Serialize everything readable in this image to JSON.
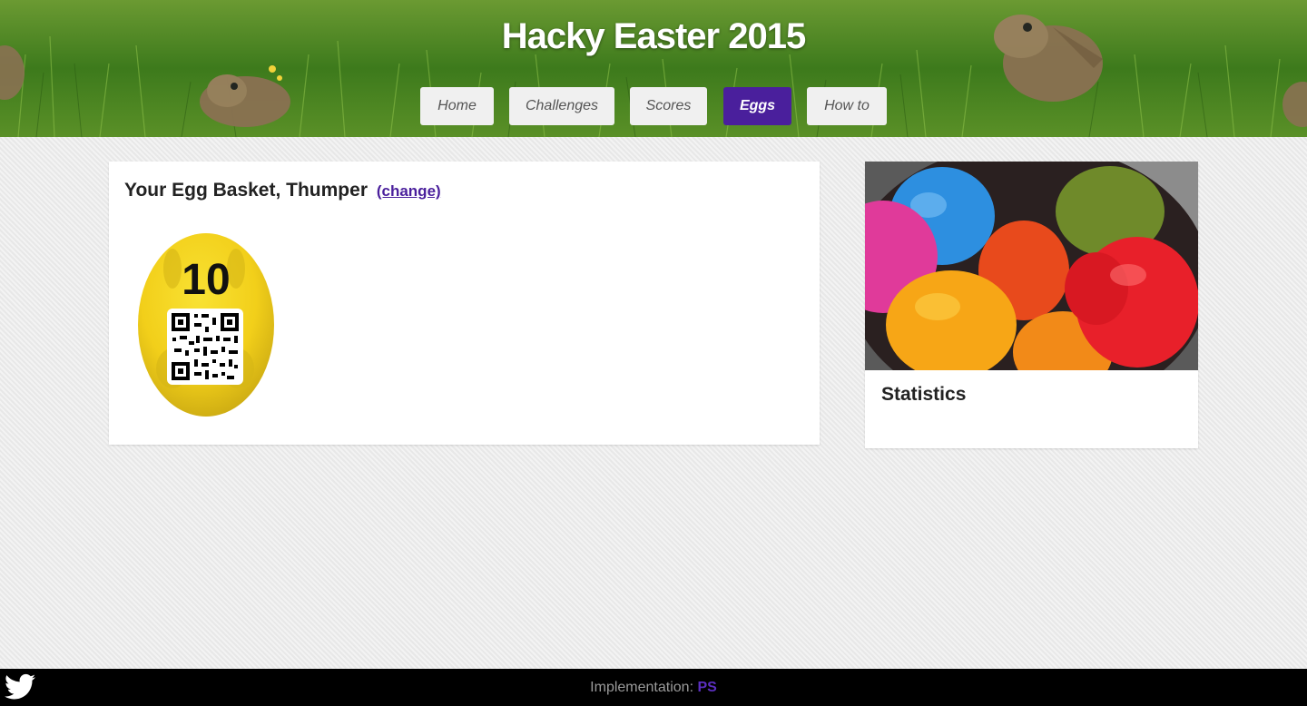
{
  "header": {
    "title": "Hacky Easter 2015",
    "nav": [
      {
        "label": "Home",
        "active": false
      },
      {
        "label": "Challenges",
        "active": false
      },
      {
        "label": "Scores",
        "active": false
      },
      {
        "label": "Eggs",
        "active": true
      },
      {
        "label": "How to",
        "active": false
      }
    ]
  },
  "basket": {
    "title": "Your Egg Basket, Thumper",
    "change_label": "(change)",
    "eggs": [
      {
        "number": "10",
        "icon": "qr-code-icon"
      }
    ]
  },
  "sidebar": {
    "statistics_title": "Statistics",
    "image_icon": "easter-eggs-photo"
  },
  "footer": {
    "implementation_label": "Implementation:",
    "author": "PS",
    "social_icon": "twitter-icon"
  },
  "colors": {
    "accent": "#4a1f9c",
    "grass": "#3f7a1f",
    "footer_bg": "#000000"
  }
}
